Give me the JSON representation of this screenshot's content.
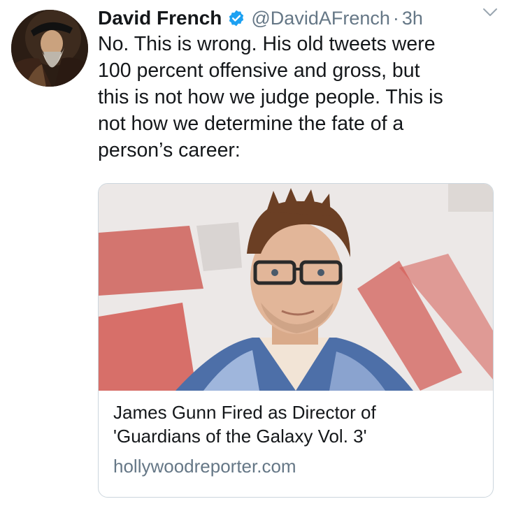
{
  "tweet": {
    "author": {
      "display_name": "David French",
      "handle": "@DavidAFrench",
      "verified": true,
      "avatar_icon": "portrait-avatar"
    },
    "separator": "·",
    "timestamp": "3h",
    "menu_icon": "chevron-down-icon",
    "text": "No. This is wrong. His old tweets were\n100 percent offensive and gross, but\nthis is not how we judge people. This is\nnot how we determine the fate of a\nperson’s career:",
    "card": {
      "title": "James Gunn Fired as Director of\n'Guardians of the Galaxy Vol. 3'",
      "domain": "hollywoodreporter.com",
      "image_icon": "headshot-photo"
    }
  },
  "colors": {
    "primary_text": "#14171a",
    "secondary_text": "#657786",
    "verified_blue": "#1da1f2",
    "card_border": "#ccd6dd"
  }
}
